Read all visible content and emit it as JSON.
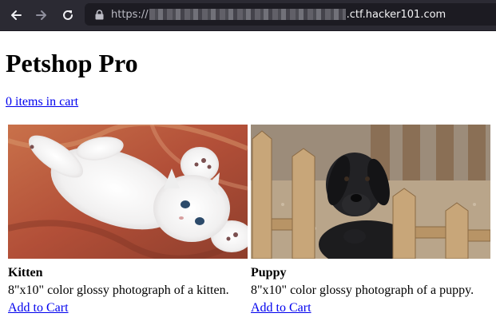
{
  "browser": {
    "url_scheme": "https://",
    "url_host_suffix": ".ctf.hacker101.com",
    "icons": {
      "back": "arrow-left-icon",
      "forward": "arrow-right-icon",
      "reload": "reload-icon",
      "lock": "lock-icon"
    }
  },
  "page": {
    "title": "Petshop Pro",
    "cart_link": "0 items in cart"
  },
  "products": [
    {
      "name": "Kitten",
      "description": "8\"x10\" color glossy photograph of a kitten.",
      "add_label": "Add to Cart",
      "image": "white kitten lying on its back"
    },
    {
      "name": "Puppy",
      "description": "8\"x10\" color glossy photograph of a puppy.",
      "add_label": "Add to Cart",
      "image": "black puppy behind wooden fence"
    }
  ],
  "colors": {
    "link": "#0000ee",
    "chrome_bg": "#2b2a33",
    "urlbar_bg": "#1c1b22"
  }
}
